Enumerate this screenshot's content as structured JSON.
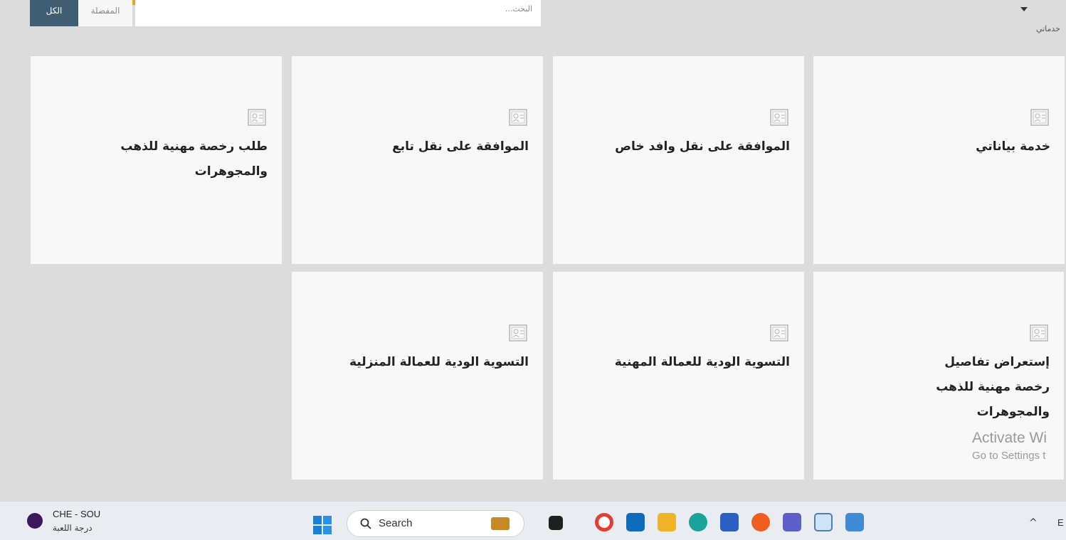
{
  "header": {
    "search_placeholder": "البحث...",
    "filter_all": "الكل",
    "filter_favorites": "المفضلة",
    "my_services": "خدماتي"
  },
  "cards": [
    {
      "title": "خدمة بياناتي"
    },
    {
      "title": "الموافقة على نقل وافد خاص"
    },
    {
      "title": "الموافقة على نقل تابع"
    },
    {
      "title": "طلب رخصة مهنية للذهب والمجوهرات"
    },
    {
      "title": "إستعراض تفاصيل رخصة مهنية للذهب والمجوهرات"
    },
    {
      "title": "التسوية الودية للعمالة المهنية"
    },
    {
      "title": "التسوية الودية للعمالة المنزلية"
    }
  ],
  "watermark": {
    "line1": "Activate Wi",
    "line2": "Go to Settings t"
  },
  "taskbar": {
    "widget_line1": "CHE - SOU",
    "widget_line2": "درجة اللعبة",
    "search_label": "Search",
    "language": "E",
    "apps": [
      "file-manager",
      "chrome",
      "outlook",
      "explorer",
      "edge",
      "store",
      "firefox",
      "teams",
      "notepad",
      "photos"
    ]
  },
  "colors": {
    "accent_orange": "#f2a51c",
    "filter_active": "#3f5e73"
  }
}
